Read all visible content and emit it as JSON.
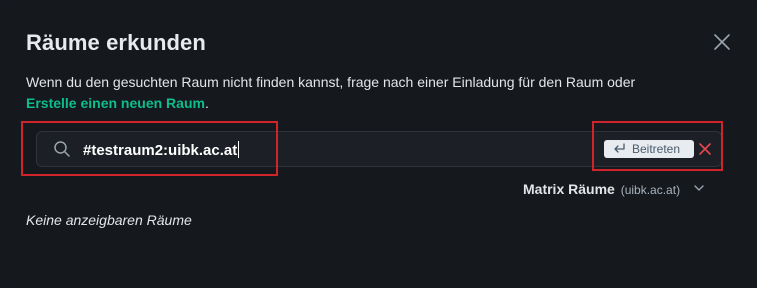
{
  "dialog": {
    "title": "Räume erkunden",
    "description": "Wenn du den gesuchten Raum nicht finden kannst, frage nach einer Einladung für den Raum oder",
    "create_link": "Erstelle einen neuen Raum",
    "create_link_suffix": "."
  },
  "search": {
    "value": "#testraum2:uibk.ac.at"
  },
  "join_button": {
    "label": "Beitreten"
  },
  "server_picker": {
    "label": "Matrix Räume",
    "server": "(uibk.ac.at)"
  },
  "results": {
    "empty_text": "Keine anzeigbaren Räume"
  },
  "colors": {
    "accent": "#0dbd8b",
    "highlight": "#d1232a",
    "background": "#15191e"
  },
  "icons": [
    "close-icon",
    "search-icon",
    "enter-icon",
    "clear-icon",
    "chevron-down-icon"
  ]
}
